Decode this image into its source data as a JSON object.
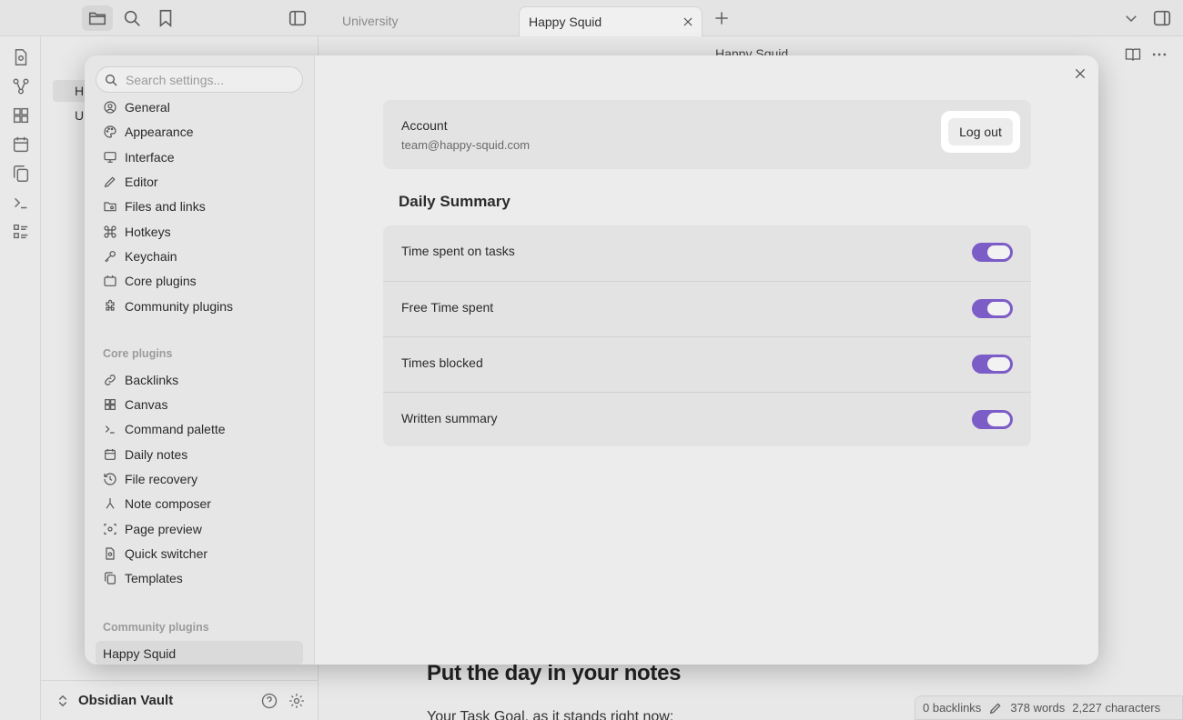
{
  "tabs": [
    {
      "label": "University",
      "active": false
    },
    {
      "label": "Happy Squid",
      "active": true
    }
  ],
  "header": {
    "note_title": "Happy Squid"
  },
  "file_explorer": {
    "partial_items": [
      "H",
      "U"
    ]
  },
  "settings": {
    "search_placeholder": "Search settings...",
    "options": [
      "General",
      "Appearance",
      "Interface",
      "Editor",
      "Files and links",
      "Hotkeys",
      "Keychain",
      "Core plugins",
      "Community plugins"
    ],
    "core_plugins_heading": "Core plugins",
    "core_plugins": [
      "Backlinks",
      "Canvas",
      "Command palette",
      "Daily notes",
      "File recovery",
      "Note composer",
      "Page preview",
      "Quick switcher",
      "Templates"
    ],
    "community_plugins_heading": "Community plugins",
    "community_plugins": [
      "Happy Squid"
    ],
    "selected": "Happy Squid"
  },
  "plugin_page": {
    "account_label": "Account",
    "account_email": "team@happy-squid.com",
    "logout_label": "Log out",
    "section_title": "Daily Summary",
    "toggles": [
      {
        "label": "Time spent on tasks",
        "on": true
      },
      {
        "label": "Free Time spent",
        "on": true
      },
      {
        "label": "Times blocked",
        "on": true
      },
      {
        "label": "Written summary",
        "on": true
      }
    ],
    "accent_color": "#7c5cc6"
  },
  "note": {
    "heading": "Put the day in your notes",
    "first_line": "Your Task Goal, as it stands right now:"
  },
  "vault": {
    "name": "Obsidian Vault"
  },
  "status_bar": {
    "backlinks": "0 backlinks",
    "words": "378 words",
    "characters": "2,227 characters"
  }
}
